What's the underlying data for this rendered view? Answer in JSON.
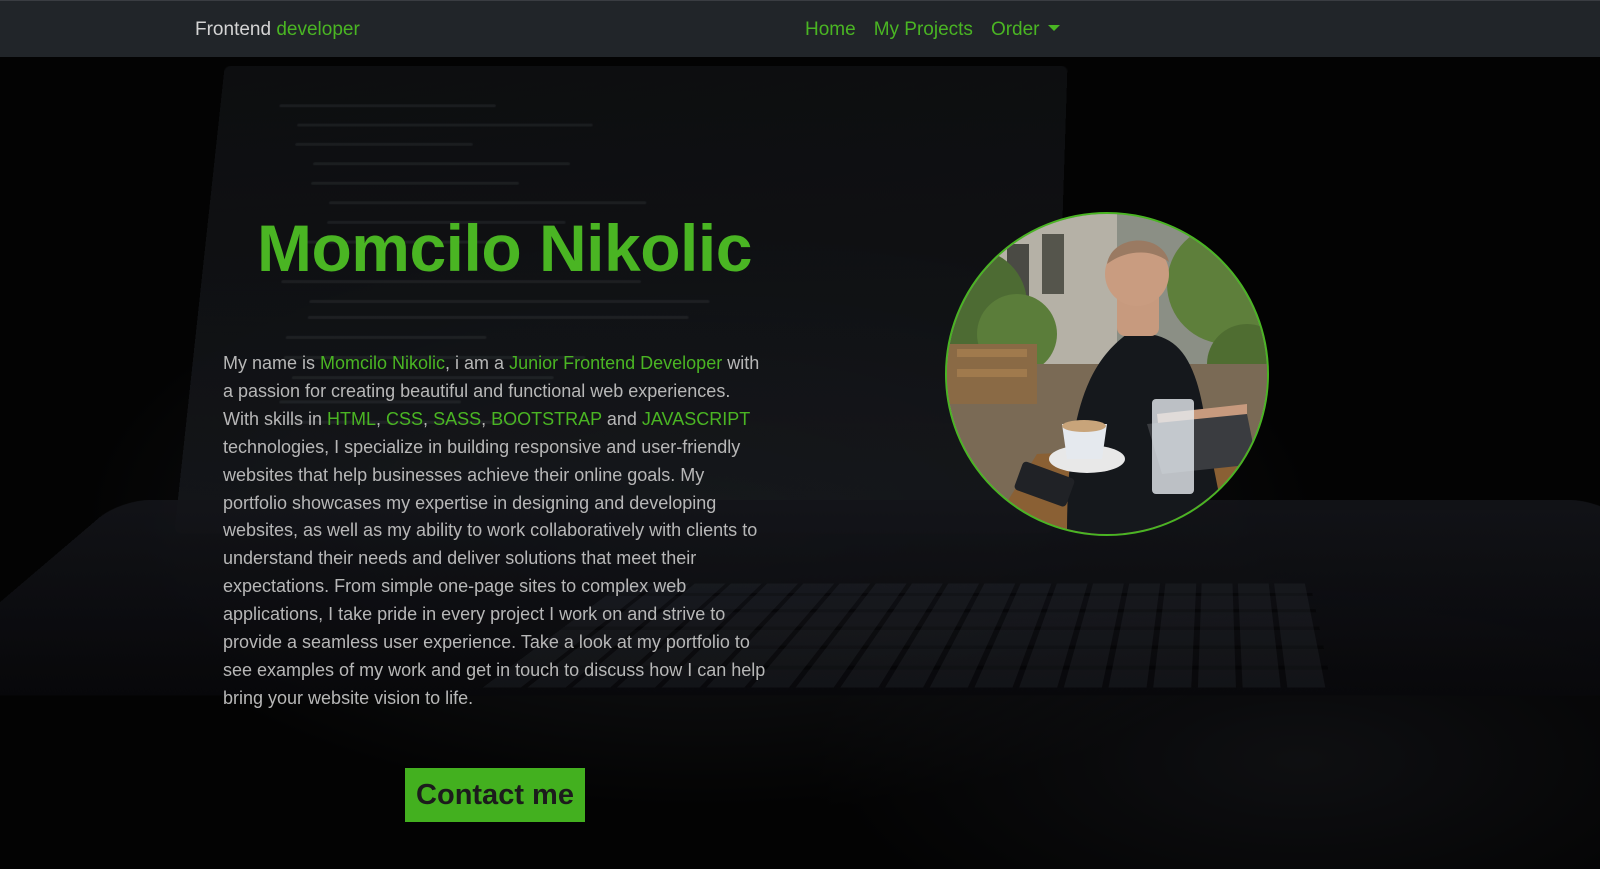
{
  "navbar": {
    "brand_prefix": "Frontend",
    "brand_accent": "developer",
    "links": [
      {
        "label": "Home"
      },
      {
        "label": "My Projects"
      },
      {
        "label": "Order"
      }
    ]
  },
  "hero": {
    "title": "Momcilo Nikolic",
    "bio": {
      "p1": "My name is ",
      "name": "Momcilo Nikolic",
      "p2": ", i am a ",
      "role": "Junior Frontend Developer",
      "p3": " with a passion for creating beautiful and functional web experiences. With skills in ",
      "skill1": "HTML",
      "c1": ", ",
      "skill2": "CSS",
      "c2": ", ",
      "skill3": "SASS",
      "c3": ", ",
      "skill4": "BOOTSTRAP",
      "c4": " and ",
      "skill5": "JAVASCRIPT",
      "p4": " technologies, I specialize in building responsive and user-friendly websites that help businesses achieve their online goals. My portfolio showcases my expertise in designing and developing websites, as well as my ability to work collaboratively with clients to understand their needs and deliver solutions that meet their expectations. From simple one-page sites to complex web applications, I take pride in every project I work on and strive to provide a seamless user experience. Take a look at my portfolio to see examples of my work and get in touch to discuss how I can help bring your website vision to life."
    },
    "contact_label": "Contact me"
  },
  "colors": {
    "accent": "#4ab523",
    "navbar_bg": "#212529",
    "text": "#b7b7b7",
    "button_bg": "#43b01f"
  },
  "icons": {
    "dropdown": "caret-down-icon"
  }
}
